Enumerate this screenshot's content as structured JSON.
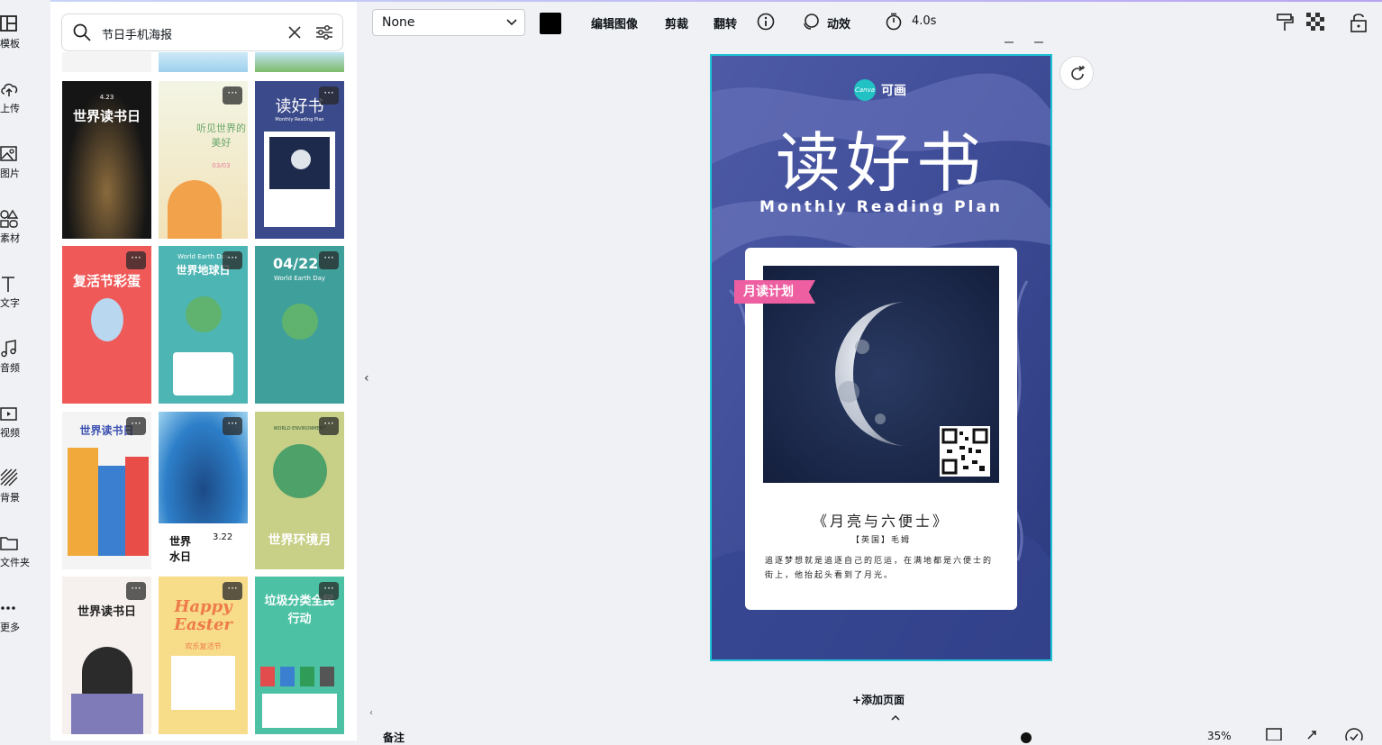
{
  "sidebar": {
    "items": [
      {
        "label": "模板",
        "icon": "layout-icon"
      },
      {
        "label": "上传",
        "icon": "upload-cloud-icon"
      },
      {
        "label": "图片",
        "icon": "image-icon"
      },
      {
        "label": "素材",
        "icon": "elements-icon"
      },
      {
        "label": "文字",
        "icon": "text-icon"
      },
      {
        "label": "音频",
        "icon": "music-icon"
      },
      {
        "label": "视频",
        "icon": "video-icon"
      },
      {
        "label": "背景",
        "icon": "background-icon"
      },
      {
        "label": "文件夹",
        "icon": "folder-icon"
      },
      {
        "label": "更多",
        "icon": "more-icon"
      }
    ]
  },
  "search": {
    "value": "节日手机海报"
  },
  "templates": [
    {
      "title": "世界读书日",
      "subtitle": "4.23"
    },
    {
      "title": "听见世界的美好",
      "subtitle": "03/03"
    },
    {
      "title": "读好书",
      "subtitle": "Monthly Reading Plan"
    },
    {
      "title": "复活节彩蛋",
      "subtitle": ""
    },
    {
      "title": "世界地球日",
      "subtitle": "World Earth Day"
    },
    {
      "title": "04/22",
      "subtitle": "World Earth Day"
    },
    {
      "title": "世界读书日",
      "subtitle": ""
    },
    {
      "title": "世界水日",
      "subtitle": "3.22"
    },
    {
      "title": "世界环境月",
      "subtitle": "WORLD ENVIRONMENT"
    },
    {
      "title": "世界读书日",
      "subtitle": ""
    },
    {
      "title": "Happy Easter",
      "subtitle": "欢乐复活节"
    },
    {
      "title": "垃圾分类全民行动",
      "subtitle": ""
    }
  ],
  "toolbar": {
    "font_select": "None",
    "color": "#000000",
    "edit_image": "编辑图像",
    "crop": "剪裁",
    "flip": "翻转",
    "animate": "动效",
    "duration": "4.0s"
  },
  "poster": {
    "logo_text": "Canva",
    "brand": "可画",
    "title": "读好书",
    "subtitle": "Monthly Reading Plan",
    "ribbon": "月读计划",
    "book": "《月亮与六便士》",
    "author": "【英国】毛姆",
    "quote": "追逐梦想就是追逐自己的厄运，在满地都是六便士的街上，他抬起头看到了月光。"
  },
  "footer": {
    "add_page": "+添加页面",
    "notes": "备注",
    "zoom": "35%"
  }
}
